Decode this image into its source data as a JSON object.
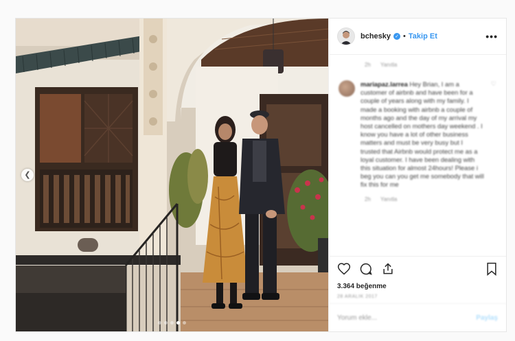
{
  "header": {
    "username": "bchesky",
    "separator": "•",
    "follow_label": "Takip Et",
    "more_label": "•••"
  },
  "top_meta": {
    "time": "2h",
    "reply": "Yanıtla"
  },
  "comment": {
    "username": "mariapaz.larrea",
    "text": "Hey Brian, I am a customer of airbnb and have been for a couple of years along with my family. I made a booking with airbnb a couple of months ago and the day of my arrival my host cancelled on mothers day weekend . I know you have a lot of other business matters and must be very busy but I trusted that Airbnb would protect me as a loyal customer. I have been dealing with this situation for almost 24hours! Please i beg you can you get me somebody that will fix this for me",
    "time": "2h",
    "reply": "Yanıtla"
  },
  "likes": "3.364 beğenme",
  "date": "28 ARALIK 2017",
  "add_comment": {
    "placeholder": "Yorum ekle...",
    "share_label": "Paylaş"
  },
  "carousel": {
    "total": 5,
    "active": 4
  },
  "icons": [
    "chevron-left-icon",
    "heart-icon",
    "comment-icon",
    "share-icon",
    "bookmark-icon",
    "verified-icon",
    "more-icon"
  ],
  "colors": {
    "accent": "#3897f0",
    "post_border": "#e6e6e6",
    "muted": "#999999"
  }
}
